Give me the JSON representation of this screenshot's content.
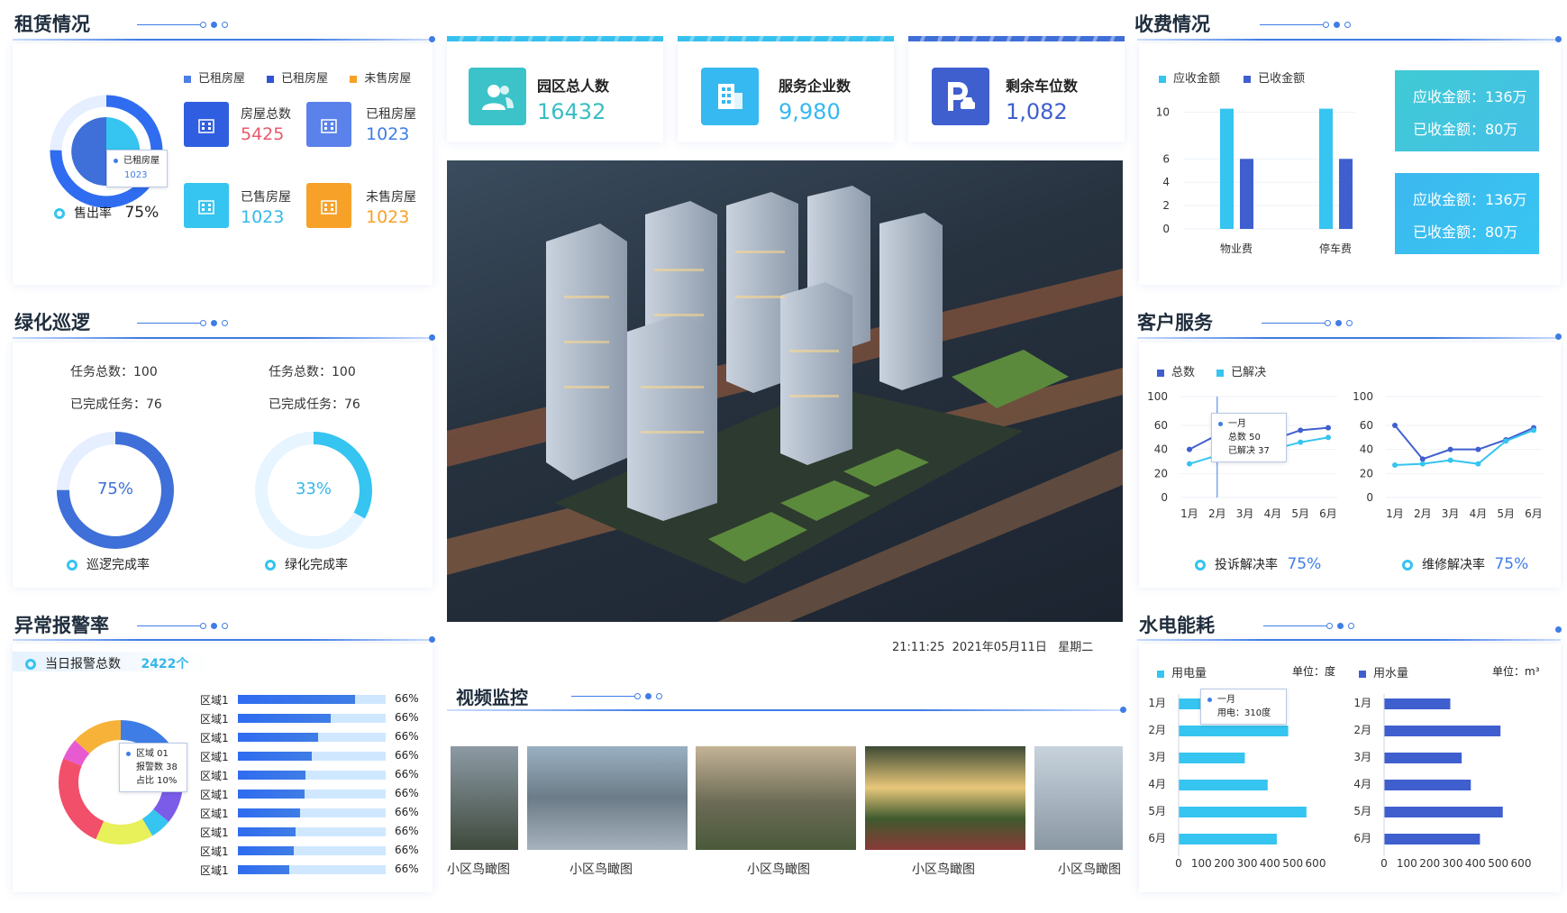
{
  "rental": {
    "title": "租赁情况",
    "legend": [
      "已租房屋",
      "已租房屋",
      "未售房屋"
    ],
    "tooltip": {
      "label": "已租房屋",
      "value": "1023"
    },
    "sell_rate_label": "售出率",
    "sell_rate_value": "75%",
    "stats": [
      {
        "label": "房屋总数",
        "value": "5425",
        "color": "#e8596c"
      },
      {
        "label": "已租房屋",
        "value": "1023",
        "color": "#3f7de6"
      },
      {
        "label": "已售房屋",
        "value": "1023",
        "color": "#36c4f0"
      },
      {
        "label": "未售房屋",
        "value": "1023",
        "color": "#f7a129"
      }
    ]
  },
  "green": {
    "title": "绿化巡逻",
    "left": {
      "total": "任务总数：100",
      "done": "已完成任务：76",
      "pct": "75%",
      "caption": "巡逻完成率",
      "fraction": 0.75
    },
    "right": {
      "total": "任务总数：100",
      "done": "已完成任务：76",
      "pct": "33%",
      "caption": "绿化完成率",
      "fraction": 0.33
    }
  },
  "alarm": {
    "title": "异常报警率",
    "today_label": "当日报警总数",
    "today_value": "2422个",
    "tooltip": {
      "line1": "区域 01",
      "line2": "报警数 38",
      "line3": "占比 10%"
    },
    "rows": [
      {
        "label": "区域1",
        "pct": "66%",
        "fill": 0.79
      },
      {
        "label": "区域1",
        "pct": "66%",
        "fill": 0.63
      },
      {
        "label": "区域1",
        "pct": "66%",
        "fill": 0.54
      },
      {
        "label": "区域1",
        "pct": "66%",
        "fill": 0.5
      },
      {
        "label": "区域1",
        "pct": "66%",
        "fill": 0.46
      },
      {
        "label": "区域1",
        "pct": "66%",
        "fill": 0.45
      },
      {
        "label": "区域1",
        "pct": "66%",
        "fill": 0.42
      },
      {
        "label": "区域1",
        "pct": "66%",
        "fill": 0.39
      },
      {
        "label": "区域1",
        "pct": "66%",
        "fill": 0.38
      },
      {
        "label": "区域1",
        "pct": "66%",
        "fill": 0.35
      }
    ]
  },
  "top_stats": [
    {
      "label": "园区总人数",
      "value": "16432",
      "icon": "people-icon"
    },
    {
      "label": "服务企业数",
      "value": "9,980",
      "icon": "building-icon"
    },
    {
      "label": "剩余车位数",
      "value": "1,082",
      "icon": "parking-icon"
    }
  ],
  "datetime": "21:11:25  2021年05月11日   星期二",
  "video": {
    "title": "视频监控",
    "items": [
      "小区鸟瞰图",
      "小区鸟瞰图",
      "小区鸟瞰图",
      "小区鸟瞰图",
      "小区鸟瞰图"
    ]
  },
  "fee": {
    "title": "收费情况",
    "legend": [
      "应收金额",
      "已收金额"
    ],
    "boxes": [
      {
        "receivable": "应收金额：136万",
        "received": "已收金额：80万"
      },
      {
        "receivable": "应收金额：136万",
        "received": "已收金额：80万"
      }
    ],
    "colors": {
      "receivable": "#36c4f0",
      "received": "#3f5fcf"
    }
  },
  "service": {
    "title": "客户服务",
    "legend": [
      "总数",
      "已解决"
    ],
    "tooltip": {
      "line1": "一月",
      "line2": "总数 50",
      "line3": "已解决 37"
    },
    "rate1_label": "投诉解决率",
    "rate1_value": "75%",
    "rate2_label": "维修解决率",
    "rate2_value": "75%"
  },
  "energy": {
    "title": "水电能耗",
    "elec_label": "用电量",
    "elec_unit": "单位：度",
    "water_label": "用水量",
    "water_unit": "单位：m³",
    "tooltip": {
      "line1": "一月",
      "line2": "用电：310度"
    }
  },
  "chart_data": [
    {
      "type": "bar",
      "title": "收费情况",
      "categories": [
        "物业费",
        "停车费"
      ],
      "series": [
        {
          "name": "应收金额",
          "values": [
            10.3,
            10.3
          ]
        },
        {
          "name": "已收金额",
          "values": [
            6,
            6
          ]
        }
      ],
      "yticks": [
        0,
        2,
        4,
        6,
        10
      ],
      "ylim": [
        0,
        10.5
      ]
    },
    {
      "type": "line",
      "categories": [
        "1月",
        "2月",
        "3月",
        "4月",
        "5月",
        "6月"
      ],
      "series": [
        {
          "name": "总数",
          "values": [
            40,
            52,
            50,
            48,
            56,
            58
          ]
        },
        {
          "name": "已解决",
          "values": [
            28,
            35,
            33,
            40,
            46,
            50
          ]
        }
      ],
      "yticks": [
        0,
        20,
        40,
        60,
        100
      ],
      "ylim": [
        0,
        100
      ]
    },
    {
      "type": "line",
      "categories": [
        "1月",
        "2月",
        "3月",
        "4月",
        "5月",
        "6月"
      ],
      "series": [
        {
          "name": "总数",
          "values": [
            60,
            32,
            40,
            40,
            48,
            58
          ]
        },
        {
          "name": "已解决",
          "values": [
            27,
            28,
            31,
            28,
            47,
            56
          ]
        }
      ],
      "yticks": [
        0,
        20,
        40,
        60,
        100
      ],
      "ylim": [
        0,
        100
      ]
    },
    {
      "type": "bar",
      "orientation": "horizontal",
      "title": "用电量",
      "categories": [
        "1月",
        "2月",
        "3月",
        "4月",
        "5月",
        "6月"
      ],
      "values": [
        310,
        480,
        290,
        390,
        560,
        430
      ],
      "xticks": [
        0,
        100,
        200,
        300,
        400,
        500,
        600
      ]
    },
    {
      "type": "bar",
      "orientation": "horizontal",
      "title": "用水量",
      "categories": [
        "1月",
        "2月",
        "3月",
        "4月",
        "5月",
        "6月"
      ],
      "values": [
        290,
        510,
        340,
        380,
        520,
        420
      ],
      "xticks": [
        0,
        100,
        200,
        300,
        400,
        500,
        600
      ]
    },
    {
      "type": "pie",
      "title": "租赁情况",
      "series": [
        {
          "name": "已租房屋",
          "values": [
            55
          ]
        },
        {
          "name": "已租房屋",
          "values": [
            20
          ]
        },
        {
          "name": "未售房屋",
          "values": [
            25
          ]
        }
      ]
    }
  ]
}
